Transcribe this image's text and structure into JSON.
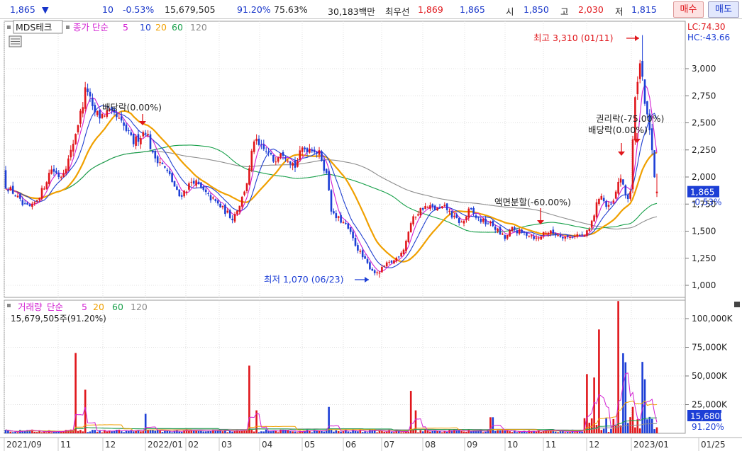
{
  "quote": {
    "price": "1,865",
    "change_arrow": "▼",
    "change": "10",
    "change_pct": "-0.53%",
    "volume": "15,679,505",
    "volume_ratio": "91.20%",
    "turnover": "75.63%",
    "amount": "30,183백만",
    "best_ask_label": "최우선",
    "best_ask": "1,869",
    "best_bid": "1,865",
    "open_label": "시",
    "open": "1,850",
    "high_label": "고",
    "high": "2,030",
    "low_label": "저",
    "low": "1,815",
    "buy_label": "매수",
    "sell_label": "매도"
  },
  "price_pane": {
    "stock_name": "MDS테크",
    "indicator_label": "종가 단순",
    "ma_periods": [
      "5",
      "10",
      "20",
      "60",
      "120"
    ],
    "lc_label": "LC:74.30",
    "hc_label": "HC:-43.66",
    "y_ticks": [
      "3,000",
      "2,750",
      "2,500",
      "2,250",
      "2,000",
      "1,750",
      "1,500",
      "1,250",
      "1,000"
    ],
    "current_price_tag": "1,865",
    "current_change_tag": "-0.53%",
    "annotations": {
      "high": "최고 3,310 (01/11)",
      "low": "최저 1,070 (06/23)",
      "dividend1": "배당락(0.00%)",
      "split": "액면분할(-60.00%)",
      "rights": "권리락(-75.00%)",
      "dividend2": "배당락(0.00%)"
    }
  },
  "volume_pane": {
    "title": "거래량",
    "indicator_label": "단순",
    "ma_periods": [
      "5",
      "20",
      "60",
      "120"
    ],
    "current_volume": "15,679,505주(91.20%)",
    "y_ticks": [
      "100,000K",
      "75,000K",
      "50,000K",
      "25,000K"
    ],
    "volume_tag": "15,680K",
    "ratio_tag": "91.20%"
  },
  "x_axis": [
    "2021/09",
    "11",
    "12",
    "2022/01",
    "02",
    "03",
    "04",
    "05",
    "06",
    "07",
    "08",
    "09",
    "10",
    "11",
    "12",
    "2023/01",
    "01/25"
  ],
  "colors": {
    "up": "#e0161b",
    "down": "#1d3fd6",
    "ma5": "#d21fd2",
    "ma10": "#2040d0",
    "ma20": "#f0a000",
    "ma60": "#18a04a",
    "ma120": "#8c8c8c"
  },
  "chart_data": {
    "type": "candlestick",
    "price_range": [
      950,
      3350
    ],
    "volume_range": [
      0,
      115000
    ],
    "volume_unit": "K shares",
    "points": [
      {
        "x": "2021/09",
        "close": 2050
      },
      {
        "x": "2021/10",
        "close": 1700
      },
      {
        "x": "2021/11",
        "close": 2700
      },
      {
        "x": "2021/12",
        "close": 2450
      },
      {
        "x": "2022/01",
        "close": 2250
      },
      {
        "x": "2022/02",
        "close": 1900
      },
      {
        "x": "2022/03",
        "close": 1650
      },
      {
        "x": "2022/04",
        "close": 2250
      },
      {
        "x": "2022/05",
        "close": 2300
      },
      {
        "x": "2022/06",
        "close": 1250
      },
      {
        "x": "2022/07",
        "close": 1250
      },
      {
        "x": "2022/08",
        "close": 1720
      },
      {
        "x": "2022/09",
        "close": 1650
      },
      {
        "x": "2022/10",
        "close": 1450
      },
      {
        "x": "2022/11",
        "close": 1500
      },
      {
        "x": "2022/12",
        "close": 2000
      },
      {
        "x": "2023/01",
        "close": 1865
      }
    ],
    "high": {
      "value": 3310,
      "date": "01/11"
    },
    "low": {
      "value": 1070,
      "date": "06/23"
    },
    "last": {
      "value": 1865,
      "change_pct": -0.53,
      "volume": 15679505
    }
  }
}
